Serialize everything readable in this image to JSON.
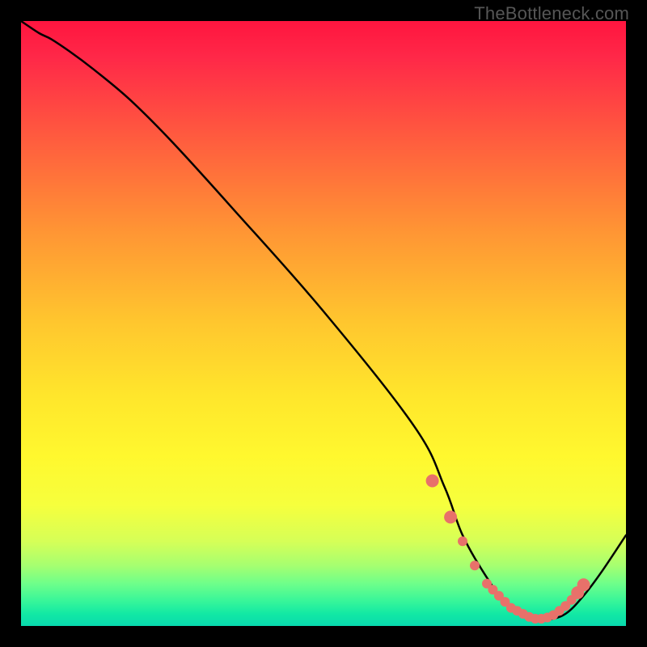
{
  "attribution": "TheBottleneck.com",
  "chart_data": {
    "type": "line",
    "title": "",
    "xlabel": "",
    "ylabel": "",
    "xlim": [
      0,
      100
    ],
    "ylim": [
      0,
      100
    ],
    "grid": false,
    "legend": false,
    "series": [
      {
        "name": "curve",
        "x": [
          0,
          3,
          5,
          8,
          12,
          18,
          25,
          35,
          50,
          65,
          70,
          73,
          77,
          80,
          83,
          85,
          87,
          90,
          93,
          96,
          100
        ],
        "y": [
          100,
          98,
          97,
          95,
          92,
          87,
          80,
          69,
          52,
          33,
          23,
          15,
          8,
          4,
          2,
          1,
          1,
          2,
          5,
          9,
          15
        ]
      }
    ],
    "markers": {
      "name": "highlight-points",
      "color": "#e8716a",
      "x": [
        68,
        71,
        73,
        75,
        77,
        78,
        79,
        80,
        81,
        82,
        83,
        84,
        85,
        86,
        87,
        88,
        89,
        90,
        91,
        92,
        93
      ],
      "y": [
        24,
        18,
        14,
        10,
        7,
        6,
        5,
        4,
        3,
        2.5,
        2,
        1.5,
        1.2,
        1.2,
        1.4,
        1.8,
        2.5,
        3.3,
        4.3,
        5.5,
        6.8
      ]
    }
  }
}
